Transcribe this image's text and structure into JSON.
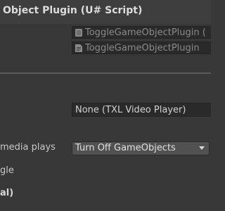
{
  "header": {
    "title": "Object Plugin (U# Script)"
  },
  "object_fields": [
    {
      "icon": "udon-program-asset-icon",
      "value": "ToggleGameObjectPlugin ("
    },
    {
      "icon": "script-file-icon",
      "value": "ToggleGameObjectPlugin"
    }
  ],
  "video_player_field": {
    "value": "None (TXL Video Player)"
  },
  "media_plays_row": {
    "label": "media plays",
    "selected": "Turn Off GameObjects"
  },
  "toggle_row": {
    "label": "gle"
  },
  "bottom_row": {
    "label": "al)"
  },
  "colors": {
    "background": "#383838",
    "header_bg": "#3e3e3e",
    "field_bg": "#2a2a2a",
    "dropdown_bg": "#515151",
    "text": "#c4c4c4"
  }
}
